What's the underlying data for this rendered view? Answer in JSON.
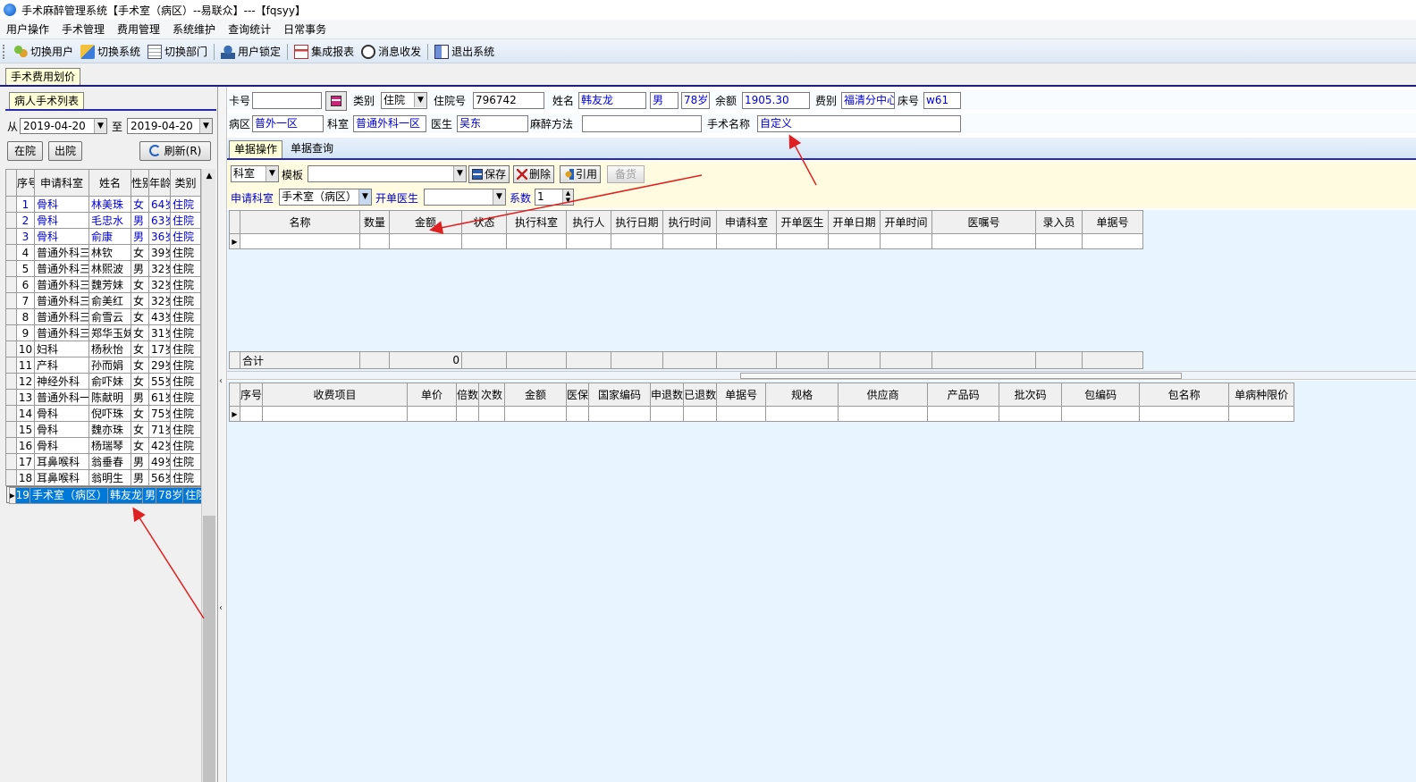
{
  "window": {
    "title": "手术麻醉管理系统【手术室（病区）--易联众】---【fqsyy】"
  },
  "menu": [
    "用户操作",
    "手术管理",
    "费用管理",
    "系统维护",
    "查询统计",
    "日常事务"
  ],
  "toolbar": {
    "switch_user": "切换用户",
    "switch_system": "切换系统",
    "switch_dept": "切换部门",
    "lock_user": "用户锁定",
    "integrated_report": "集成报表",
    "message": "消息收发",
    "exit": "退出系统"
  },
  "main_tab": "手术费用划价",
  "left": {
    "tab": "病人手术列表",
    "from_label": "从",
    "to_label": "至",
    "date_from": "2019-04-20",
    "date_to": "2019-04-20",
    "in_hospital": "在院",
    "out_hospital": "出院",
    "refresh": "刷新(R)",
    "headers": {
      "seq": "序号",
      "dept": "申请科室",
      "name": "姓名",
      "sex": "性别",
      "age": "年龄",
      "type": "类别"
    },
    "patients": [
      {
        "seq": "1",
        "dept": "骨科",
        "name": "林美珠",
        "sex": "女",
        "age": "64岁",
        "type": "住院"
      },
      {
        "seq": "2",
        "dept": "骨科",
        "name": "毛忠水",
        "sex": "男",
        "age": "63岁",
        "type": "住院"
      },
      {
        "seq": "3",
        "dept": "骨科",
        "name": "俞康",
        "sex": "男",
        "age": "36岁",
        "type": "住院"
      },
      {
        "seq": "4",
        "dept": "普通外科三",
        "name": "林钦",
        "sex": "女",
        "age": "39岁",
        "type": "住院"
      },
      {
        "seq": "5",
        "dept": "普通外科三",
        "name": "林熙波",
        "sex": "男",
        "age": "32岁",
        "type": "住院"
      },
      {
        "seq": "6",
        "dept": "普通外科三",
        "name": "魏芳妹",
        "sex": "女",
        "age": "32岁",
        "type": "住院"
      },
      {
        "seq": "7",
        "dept": "普通外科三",
        "name": "俞美红",
        "sex": "女",
        "age": "32岁",
        "type": "住院"
      },
      {
        "seq": "8",
        "dept": "普通外科三",
        "name": "俞雪云",
        "sex": "女",
        "age": "43岁",
        "type": "住院"
      },
      {
        "seq": "9",
        "dept": "普通外科三",
        "name": "郑华玉妹",
        "sex": "女",
        "age": "31岁",
        "type": "住院"
      },
      {
        "seq": "10",
        "dept": "妇科",
        "name": "杨秋怡",
        "sex": "女",
        "age": "17岁",
        "type": "住院"
      },
      {
        "seq": "11",
        "dept": "产科",
        "name": "孙而娟",
        "sex": "女",
        "age": "29岁",
        "type": "住院"
      },
      {
        "seq": "12",
        "dept": "神经外科",
        "name": "俞吓妹",
        "sex": "女",
        "age": "55岁",
        "type": "住院"
      },
      {
        "seq": "13",
        "dept": "普通外科一",
        "name": "陈献明",
        "sex": "男",
        "age": "61岁",
        "type": "住院"
      },
      {
        "seq": "14",
        "dept": "骨科",
        "name": "倪吓珠",
        "sex": "女",
        "age": "75岁",
        "type": "住院"
      },
      {
        "seq": "15",
        "dept": "骨科",
        "name": "魏亦珠",
        "sex": "女",
        "age": "71岁",
        "type": "住院"
      },
      {
        "seq": "16",
        "dept": "骨科",
        "name": "杨瑞琴",
        "sex": "女",
        "age": "42岁",
        "type": "住院"
      },
      {
        "seq": "17",
        "dept": "耳鼻喉科",
        "name": "翁垂春",
        "sex": "男",
        "age": "49岁",
        "type": "住院"
      },
      {
        "seq": "18",
        "dept": "耳鼻喉科",
        "name": "翁明生",
        "sex": "男",
        "age": "56岁",
        "type": "住院"
      },
      {
        "seq": "19",
        "dept": "手术室（病区）",
        "name": "韩友龙",
        "sex": "男",
        "age": "78岁",
        "type": "住院"
      }
    ]
  },
  "form": {
    "card_label": "卡号",
    "card_value": "",
    "category_label": "类别",
    "category_value": "住院",
    "admission_label": "住院号",
    "admission_value": "796742",
    "name_label": "姓名",
    "name_value": "韩友龙",
    "sex_value": "男",
    "age_value": "78岁",
    "balance_label": "余额",
    "balance_value": "1905.30",
    "fee_label": "费别",
    "fee_value": "福清分中心",
    "bed_label": "床号",
    "bed_value": "w61",
    "ward_label": "病区",
    "ward_value": "普外一区",
    "dept_label": "科室",
    "dept_value": "普通外科一区",
    "doctor_label": "医生",
    "doctor_value": "吴东",
    "anesthesia_label": "麻醉方法",
    "anesthesia_value": "",
    "surgery_label": "手术名称",
    "surgery_value": "自定义"
  },
  "subtabs": {
    "doc_ops": "单据操作",
    "doc_query": "单据查询"
  },
  "ops": {
    "scope_value": "科室",
    "template_label": "模板",
    "template_value": "",
    "save": "保存",
    "delete": "删除",
    "reference": "引用",
    "stock": "备货",
    "apply_dept_label": "申请科室",
    "apply_dept_value": "手术室（病区）",
    "order_doctor_label": "开单医生",
    "order_doctor_value": "",
    "coef_label": "系数",
    "coef_value": "1"
  },
  "grid1": {
    "headers": [
      "名称",
      "数量",
      "金额",
      "状态",
      "执行科室",
      "执行人",
      "执行日期",
      "执行时间",
      "申请科室",
      "开单医生",
      "开单日期",
      "开单时间",
      "医嘱号",
      "录入员",
      "单据号"
    ],
    "total_label": "合计",
    "total_amount": "0"
  },
  "grid2": {
    "headers": [
      "序号",
      "收费项目",
      "单价",
      "倍数",
      "次数",
      "金额",
      "医保",
      "国家编码",
      "申退数",
      "已退数",
      "单据号",
      "规格",
      "供应商",
      "产品码",
      "批次码",
      "包编码",
      "包名称",
      "单病种限价"
    ]
  }
}
